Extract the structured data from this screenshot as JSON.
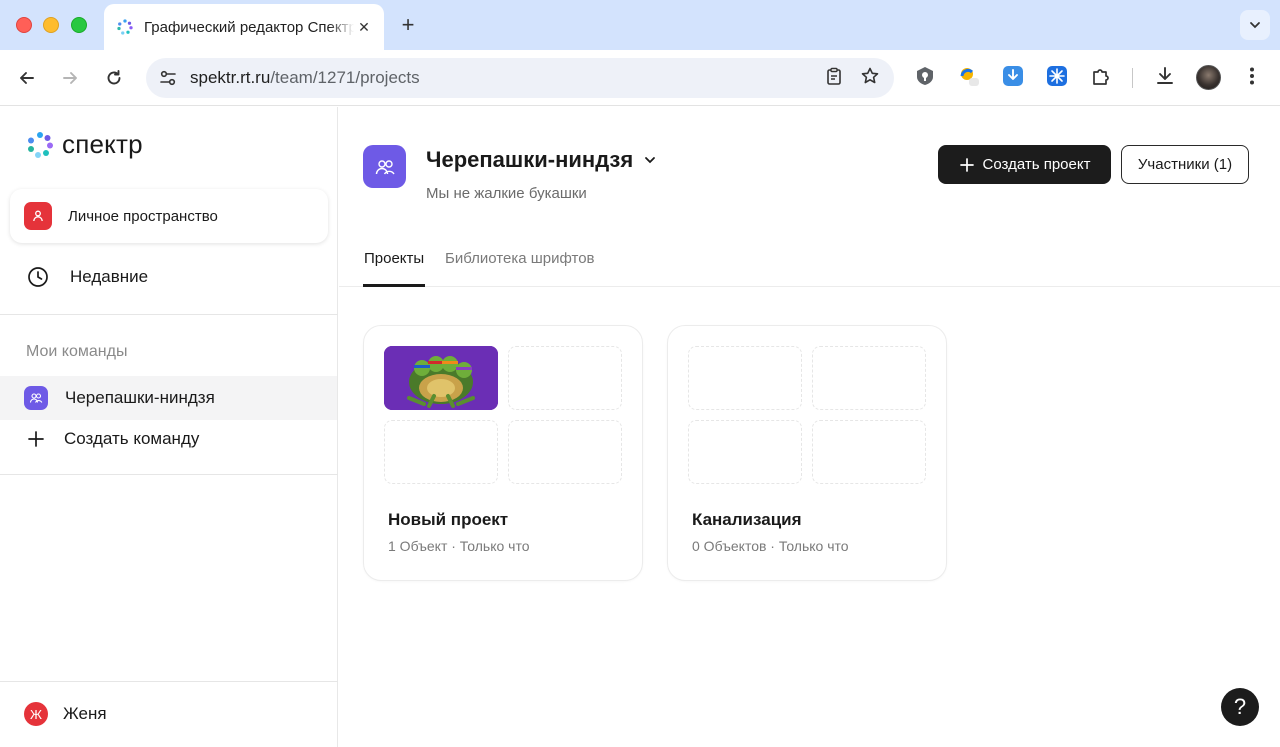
{
  "browser": {
    "tab_title": "Графический редактор Спектр",
    "tab_close": "✕",
    "new_tab": "+",
    "url_host": "spektr.rt.ru",
    "url_path": "/team/1271/projects"
  },
  "sidebar": {
    "logo_text": "спектр",
    "personal_space": "Личное пространство",
    "recent": "Недавние",
    "teams_header": "Мои команды",
    "teams": [
      {
        "label": "Черепашки-ниндзя"
      }
    ],
    "create_team": "Создать команду",
    "user": {
      "initial": "Ж",
      "name": "Женя"
    }
  },
  "main": {
    "team_name": "Черепашки-ниндзя",
    "team_description": "Мы не жалкие букашки",
    "create_project_button": "Создать проект",
    "members_button": "Участники (1)",
    "tabs": [
      {
        "label": "Проекты",
        "active": true
      },
      {
        "label": "Библиотека шрифтов",
        "active": false
      }
    ],
    "projects": [
      {
        "title": "Новый проект",
        "meta": "1 Объект · Только что"
      },
      {
        "title": "Канализация",
        "meta": "0 Объектов · Только что"
      }
    ],
    "help_button": "?"
  },
  "colors": {
    "accent_team": "#6e5ae6",
    "accent_personal": "#e5333a",
    "primary_button": "#1c1c1c",
    "chrome_tabbar": "#d3e3fd"
  }
}
